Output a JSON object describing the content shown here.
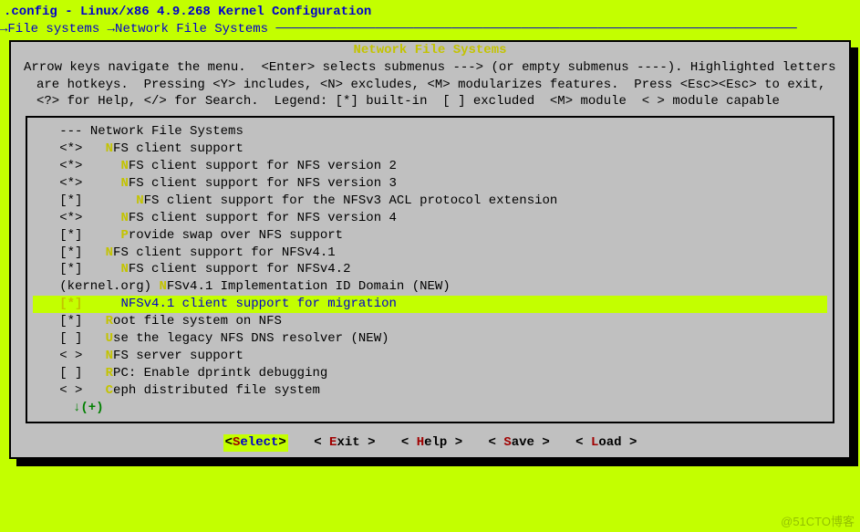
{
  "header": {
    "title": ".config - Linux/x86 4.9.268 Kernel Configuration"
  },
  "breadcrumb": {
    "arrow1": "→",
    "seg1": "File systems",
    "arrow2": "→",
    "seg2": "Network File Systems",
    "line_fill": " ────────────────────────────────────────────────────────────────────"
  },
  "dialog": {
    "title": "Network File Systems",
    "help": "Arrow keys navigate the menu.  <Enter> selects submenus ---> (or empty submenus ----). Highlighted letters are hotkeys.  Pressing <Y> includes, <N> excludes, <M> modularizes features.  Press <Esc><Esc> to exit, <?> for Help, </> for Search.  Legend: [*] built-in  [ ] excluded  <M> module  < > module capable"
  },
  "menu": {
    "items": [
      {
        "mark": "   ---",
        "pre": " ",
        "hot": "",
        "label": "Network File Systems"
      },
      {
        "mark": "   <*>",
        "pre": "   ",
        "hot": "N",
        "label": "FS client support"
      },
      {
        "mark": "   <*>",
        "pre": "     ",
        "hot": "N",
        "label": "FS client support for NFS version 2"
      },
      {
        "mark": "   <*>",
        "pre": "     ",
        "hot": "N",
        "label": "FS client support for NFS version 3"
      },
      {
        "mark": "   [*]",
        "pre": "       ",
        "hot": "N",
        "label": "FS client support for the NFSv3 ACL protocol extension"
      },
      {
        "mark": "   <*>",
        "pre": "     ",
        "hot": "N",
        "label": "FS client support for NFS version 4"
      },
      {
        "mark": "   [*]",
        "pre": "     ",
        "hot": "P",
        "label": "rovide swap over NFS support"
      },
      {
        "mark": "   [*]",
        "pre": "   ",
        "hot": "N",
        "label": "FS client support for NFSv4.1"
      },
      {
        "mark": "   [*]",
        "pre": "     ",
        "hot": "N",
        "label": "FS client support for NFSv4.2"
      },
      {
        "mark": "   (kernel.org)",
        "pre": " ",
        "hot": "N",
        "label": "FSv4.1 Implementation ID Domain (NEW)"
      },
      {
        "mark": "   [*]",
        "pre": "     ",
        "hot": "NF",
        "label": "Sv4.1 client support for migration",
        "selected": true
      },
      {
        "mark": "   [*]",
        "pre": "   ",
        "hot": "R",
        "label": "oot file system on NFS"
      },
      {
        "mark": "   [ ]",
        "pre": "   ",
        "hot": "U",
        "label": "se the legacy NFS DNS resolver (NEW)"
      },
      {
        "mark": "   < >",
        "pre": "   ",
        "hot": "N",
        "label": "FS server support"
      },
      {
        "mark": "   [ ]",
        "pre": "   ",
        "hot": "R",
        "label": "PC: Enable dprintk debugging"
      },
      {
        "mark": "   < >",
        "pre": "   ",
        "hot": "C",
        "label": "eph distributed file system"
      }
    ],
    "more": "↓(+)"
  },
  "buttons": {
    "select": {
      "open": "<",
      "hot": "S",
      "rest": "elect",
      "close": ">"
    },
    "exit": {
      "open": "< ",
      "hot": "E",
      "rest": "xit ",
      "close": ">"
    },
    "help": {
      "open": "< ",
      "hot": "H",
      "rest": "elp ",
      "close": ">"
    },
    "save": {
      "open": "< ",
      "hot": "S",
      "rest": "ave ",
      "close": ">"
    },
    "load": {
      "open": "< ",
      "hot": "L",
      "rest": "oad ",
      "close": ">"
    }
  },
  "watermark": "@51CTO博客"
}
